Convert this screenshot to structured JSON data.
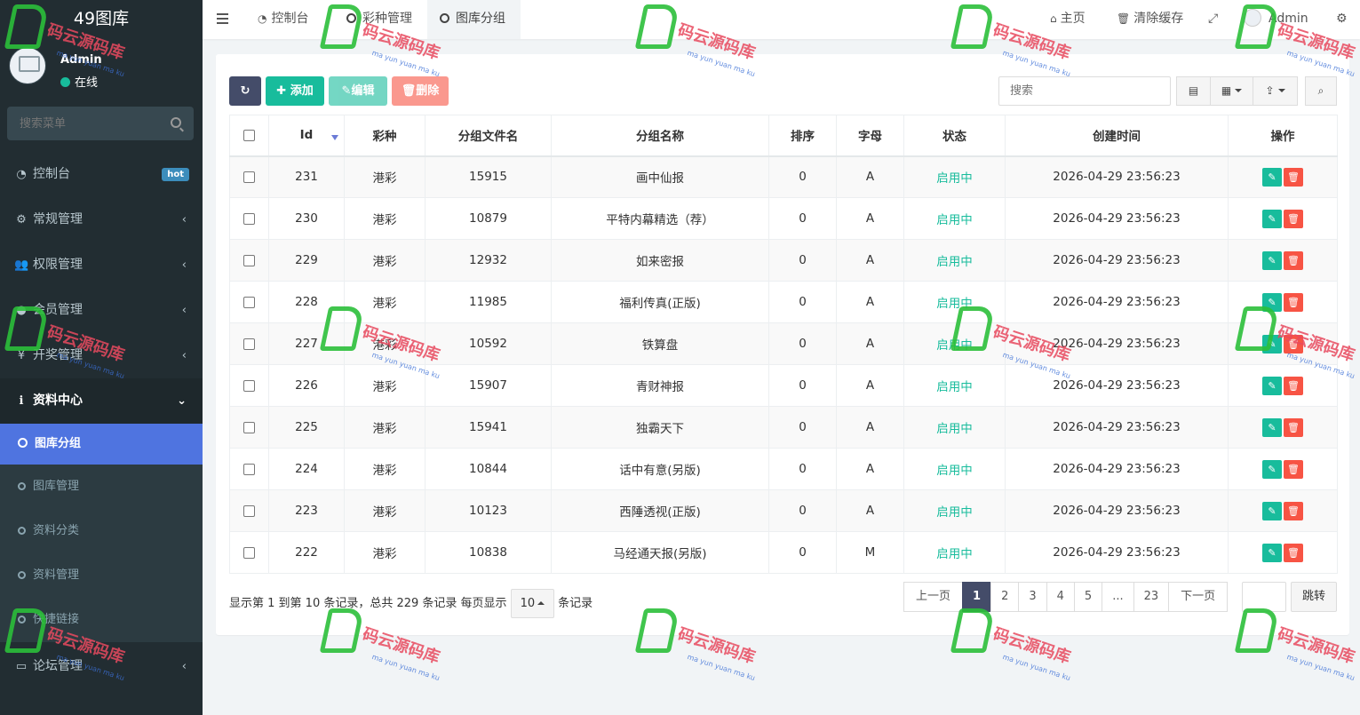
{
  "sidebar": {
    "logo": "49图库",
    "user_name": "Admin",
    "user_status": "在线",
    "search_placeholder": "搜索菜单",
    "menu": {
      "dashboard": {
        "label": "控制台",
        "badge": "hot"
      },
      "general": {
        "label": "常规管理"
      },
      "permission": {
        "label": "权限管理"
      },
      "member": {
        "label": "会员管理"
      },
      "lottery": {
        "label": "开奖管理"
      },
      "info": {
        "label": "资料中心"
      },
      "sub": [
        "图库分组",
        "图库管理",
        "资料分类",
        "资料管理",
        "快捷链接"
      ],
      "forum": {
        "label": "论坛管理"
      }
    }
  },
  "topbar": {
    "tabs": [
      "控制台",
      "彩种管理",
      "图库分组"
    ],
    "home": "主页",
    "clear_cache": "清除缓存",
    "user": "Admin"
  },
  "toolbar": {
    "add": "添加",
    "edit": "编辑",
    "delete": "删除",
    "search_placeholder": "搜索"
  },
  "table": {
    "headers": [
      "Id",
      "彩种",
      "分组文件名",
      "分组名称",
      "排序",
      "字母",
      "状态",
      "创建时间",
      "操作"
    ],
    "rows": [
      {
        "id": "231",
        "kind": "港彩",
        "file": "15915",
        "name": "画中仙报",
        "sort": "0",
        "letter": "A",
        "status": "启用中",
        "time": "2026-04-29 23:56:23"
      },
      {
        "id": "230",
        "kind": "港彩",
        "file": "10879",
        "name": "平特内幕精选（荐）",
        "sort": "0",
        "letter": "A",
        "status": "启用中",
        "time": "2026-04-29 23:56:23"
      },
      {
        "id": "229",
        "kind": "港彩",
        "file": "12932",
        "name": "如来密报",
        "sort": "0",
        "letter": "A",
        "status": "启用中",
        "time": "2026-04-29 23:56:23"
      },
      {
        "id": "228",
        "kind": "港彩",
        "file": "11985",
        "name": "福利传真(正版)",
        "sort": "0",
        "letter": "A",
        "status": "启用中",
        "time": "2026-04-29 23:56:23"
      },
      {
        "id": "227",
        "kind": "港彩",
        "file": "10592",
        "name": "铁算盘",
        "sort": "0",
        "letter": "A",
        "status": "启用中",
        "time": "2026-04-29 23:56:23"
      },
      {
        "id": "226",
        "kind": "港彩",
        "file": "15907",
        "name": "青财神报",
        "sort": "0",
        "letter": "A",
        "status": "启用中",
        "time": "2026-04-29 23:56:23"
      },
      {
        "id": "225",
        "kind": "港彩",
        "file": "15941",
        "name": "独霸天下",
        "sort": "0",
        "letter": "A",
        "status": "启用中",
        "time": "2026-04-29 23:56:23"
      },
      {
        "id": "224",
        "kind": "港彩",
        "file": "10844",
        "name": "话中有意(另版)",
        "sort": "0",
        "letter": "A",
        "status": "启用中",
        "time": "2026-04-29 23:56:23"
      },
      {
        "id": "223",
        "kind": "港彩",
        "file": "10123",
        "name": "西陲透视(正版)",
        "sort": "0",
        "letter": "A",
        "status": "启用中",
        "time": "2026-04-29 23:56:23"
      },
      {
        "id": "222",
        "kind": "港彩",
        "file": "10838",
        "name": "马经通天报(另版)",
        "sort": "0",
        "letter": "M",
        "status": "启用中",
        "time": "2026-04-29 23:56:23"
      }
    ]
  },
  "footer": {
    "info_prefix": "显示第 1 到第 10 条记录，总共 229 条记录 每页显示",
    "page_size": "10",
    "info_suffix": "条记录",
    "prev": "上一页",
    "pages": [
      "1",
      "2",
      "3",
      "4",
      "5",
      "...",
      "23"
    ],
    "next": "下一页",
    "jump": "跳转"
  },
  "watermark": {
    "text": "码云源码库",
    "sub": "ma yun yuan ma ku"
  },
  "colors": {
    "sidebar_bg": "#222d32",
    "active_blue": "#4f74e0",
    "accent_green": "#18bc9c",
    "danger_red": "#f75444",
    "dark_btn": "#444c69"
  }
}
